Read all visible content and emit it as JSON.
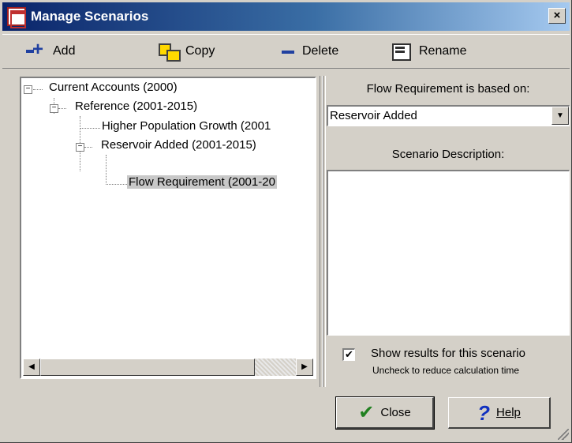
{
  "window": {
    "title": "Manage Scenarios",
    "close_glyph": "×"
  },
  "toolbar": {
    "add_label": "Add",
    "copy_label": "Copy",
    "delete_label": "Delete",
    "rename_label": "Rename"
  },
  "tree": {
    "nodes": [
      {
        "label": "Current Accounts (2000)",
        "expanded": true,
        "selected": false
      },
      {
        "label": "Reference (2001-2015)",
        "expanded": true,
        "selected": false
      },
      {
        "label": "Higher Population Growth (2001",
        "expanded": null,
        "selected": false
      },
      {
        "label": "Reservoir Added (2001-2015)",
        "expanded": true,
        "selected": false
      },
      {
        "label": "Flow Requirement (2001-20",
        "expanded": null,
        "selected": true
      }
    ]
  },
  "right": {
    "based_on_label": "Flow Requirement is based on:",
    "based_on_value": "Reservoir Added",
    "description_label": "Scenario Description:",
    "description_value": "",
    "show_results_label": "Show results for this scenario",
    "show_results_checked": true,
    "show_results_hint": "Uncheck to reduce calculation time"
  },
  "buttons": {
    "close_label": "Close",
    "help_label": "Help"
  },
  "icons": {
    "app": "manage-scenarios-app-icon",
    "add": "add-icon",
    "copy": "copy-icon",
    "delete": "delete-icon",
    "rename": "rename-icon",
    "close": "checkmark-icon",
    "help": "question-mark-icon"
  }
}
